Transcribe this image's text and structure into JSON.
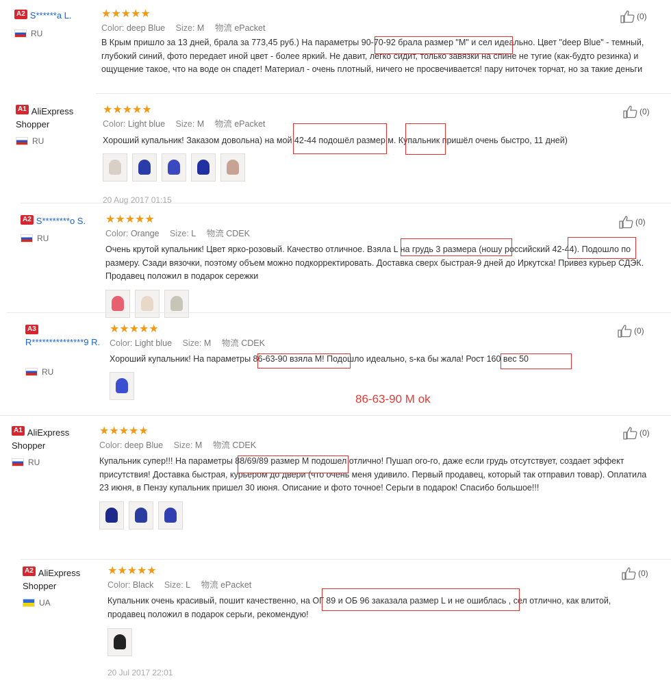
{
  "reviews": [
    {
      "badge": "A2",
      "name": "S******a L.",
      "country": "RU",
      "flag": "ru",
      "rating_stars": "★★★★★",
      "meta": {
        "color_label": "Color:",
        "color": "deep Blue",
        "size_label": "Size:",
        "size": "M",
        "ship_label": "物流",
        "ship": "ePacket"
      },
      "text": "В Крым пришло за 13 дней, брала за 773,45 руб.)  На параметры 90-70-92 брала размер \"M\" и сел идеально.  Цвет  \"deep Blue\" - темный, глубокий синий, фото передает иной цвет -  более яркий.  Не давит, легко сидит, только завязки на спине не тугие (как-будто резинка) и ощущение такое, что на воде он спадет! Материал - очень плотный, ничего не просвечивается! пару ниточек торчат, но за такие деньги качественно сделан!  Модель купальника - Andzhelika (снизу плотный пуш-ап), в",
      "likes": "(0)",
      "date": ""
    },
    {
      "badge": "A1",
      "name": "AliExpress Shopper",
      "country": "RU",
      "flag": "ru",
      "rating_stars": "★★★★★",
      "meta": {
        "color_label": "Color:",
        "color": "Light blue",
        "size_label": "Size:",
        "size": "M",
        "ship_label": "物流",
        "ship": "ePacket"
      },
      "text": "Хороший купальник! Заказом довольна) на мой 42-44 подошёл размер м. Купальник пришёл очень быстро, 11 дней)",
      "likes": "(0)",
      "date": "20 Aug 2017 01:15"
    },
    {
      "badge": "A2",
      "name": "S********o S.",
      "country": "RU",
      "flag": "ru",
      "rating_stars": "★★★★★",
      "meta": {
        "color_label": "Color:",
        "color": "Orange",
        "size_label": "Size:",
        "size": "L",
        "ship_label": "物流",
        "ship": "CDEK"
      },
      "text": "Очень крутой купальник! Цвет ярко-розовый. Качество отличное. Взяла L на грудь 3 размера (ношу российский 42-44). Подошло по размеру. Сзади вязочки, поэтому объем можно подкорректировать. Доставка сверх быстрая-9 дней до Иркутска! Привез курьер СДЭК. Продавец положил в подарок сережки",
      "likes": "(0)",
      "date": ""
    },
    {
      "badge": "A3",
      "name": "R***************9 R.",
      "country": "RU",
      "flag": "ru",
      "rating_stars": "★★★★★",
      "meta": {
        "color_label": "Color:",
        "color": "Light blue",
        "size_label": "Size:",
        "size": "M",
        "ship_label": "物流",
        "ship": "CDEK"
      },
      "text": "Хороший купальник! На параметры 86-63-90 взяла М! Подошло идеально, s-ка бы жала! Рост 160 вес 50",
      "likes": "(0)",
      "date": ""
    },
    {
      "badge": "A1",
      "name": "AliExpress Shopper",
      "country": "RU",
      "flag": "ru",
      "rating_stars": "★★★★★",
      "meta": {
        "color_label": "Color:",
        "color": "deep Blue",
        "size_label": "Size:",
        "size": "M",
        "ship_label": "物流",
        "ship": "CDEK"
      },
      "text": "Купальник супер!!! На параметры 88/69/89 размер М подошел отлично! Пушап ого-го, даже если грудь отсутствует, создает эффект присутствия! Доставка быстрая, курьером до двери (что очень меня удивило. Первый продавец, который так отправил товар). Оплатила 23 июня, в Пензу купальник пришел 30 июня. Описание и фото точное! Серьги в подарок! Спасибо большое!!!",
      "likes": "(0)",
      "date": ""
    },
    {
      "badge": "A2",
      "name": "AliExpress Shopper",
      "country": "UA",
      "flag": "ua",
      "rating_stars": "★★★★★",
      "meta": {
        "color_label": "Color:",
        "color": "Black",
        "size_label": "Size:",
        "size": "L",
        "ship_label": "物流",
        "ship": "ePacket"
      },
      "text": "Купальник очень красивый, пошит качественно, на ОГ 89 и ОБ 96 заказала размер L и не ошиблась , сел отлично, как влитой, продавец положил в подарок серьги, рекомендую!",
      "likes": "(0)",
      "date": "20 Jul 2017 22:01"
    }
  ],
  "annotation": "86-63-90 M ok",
  "colors": {
    "accent_red": "#e0322e",
    "star": "#f29a16",
    "link": "#1a64cf",
    "badge": "#d8262e"
  },
  "icons": [
    "thumbs-up-icon",
    "flag-ru-icon",
    "flag-ua-icon",
    "star-icon"
  ]
}
